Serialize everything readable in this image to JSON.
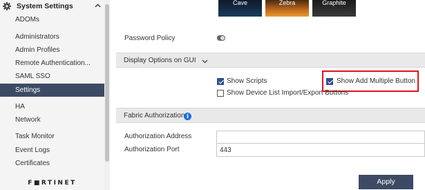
{
  "sidebar": {
    "header_title": "System Settings",
    "items": [
      {
        "label": "ADOMs"
      },
      {
        "label": "Administrators"
      },
      {
        "label": "Admin Profiles"
      },
      {
        "label": "Remote Authentication..."
      },
      {
        "label": "SAML SSO"
      },
      {
        "label": "Settings",
        "active": true
      },
      {
        "label": "HA"
      },
      {
        "label": "Network"
      },
      {
        "label": "Task Monitor"
      },
      {
        "label": "Event Logs"
      },
      {
        "label": "Certificates"
      }
    ],
    "logo": "F■RTINET"
  },
  "themes": [
    {
      "label": "Cave"
    },
    {
      "label": "Zebra"
    },
    {
      "label": "Graphite"
    }
  ],
  "settings": {
    "password_policy_label": "Password Policy",
    "password_policy_enabled": false,
    "display_options_title": "Display Options on GUI",
    "show_scripts_label": "Show Scripts",
    "show_scripts_checked": true,
    "show_add_multiple_label": "Show Add Multiple Button",
    "show_add_multiple_checked": true,
    "show_device_list_label": "Show Device List Import/Export Buttons",
    "show_device_list_checked": false,
    "fabric_auth_title": "Fabric Authorization",
    "auth_address_label": "Authorization Address",
    "auth_address_value": "",
    "auth_port_label": "Authorization Port",
    "auth_port_value": "443",
    "apply_label": "Apply"
  },
  "colors": {
    "accent": "#3d4a64",
    "highlight_border": "#e0141e",
    "info_icon": "#1f6fd6"
  }
}
